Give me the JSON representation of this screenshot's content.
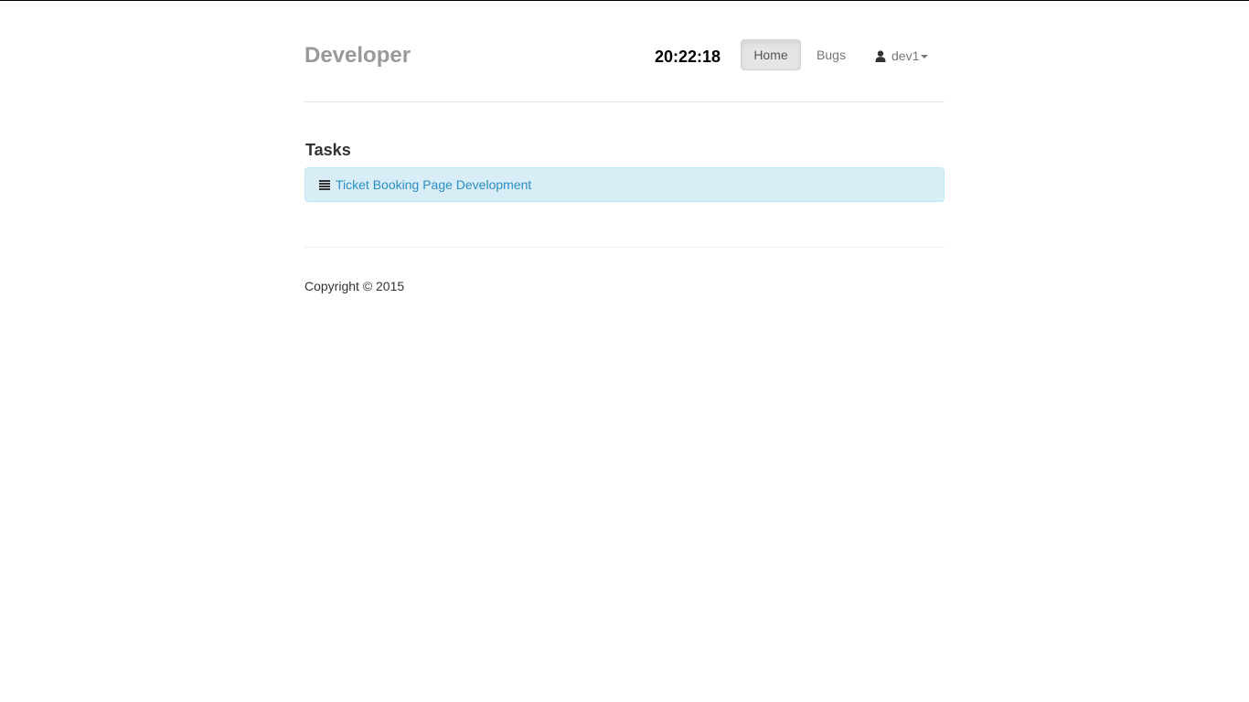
{
  "header": {
    "brand": "Developer",
    "clock": "20:22:18",
    "nav": {
      "home_label": "Home",
      "bugs_label": "Bugs",
      "user_label": "dev1"
    },
    "icons": {
      "user": "user-icon",
      "caret": "caret-down-icon"
    }
  },
  "main": {
    "section_title": "Tasks",
    "tasks": [
      {
        "label": "Ticket Booking Page Development",
        "icon": "list-icon"
      }
    ]
  },
  "footer": {
    "copyright": "Copyright © 2015"
  },
  "colors": {
    "brand": "#999999",
    "link": "#2a8ec4",
    "alert_bg": "#d9edf7",
    "alert_border": "#bce8f1",
    "active_nav_bg": "#e5e5e5"
  }
}
